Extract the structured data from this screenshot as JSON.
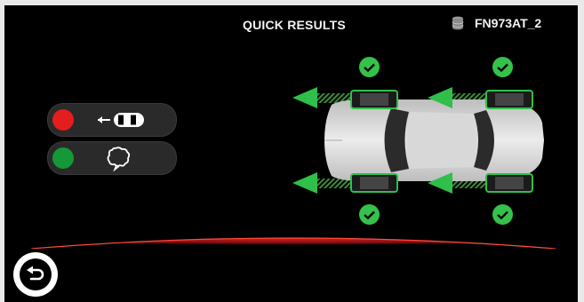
{
  "header": {
    "title": "QUICK RESULTS",
    "vehicle_id": "FN973AT_2",
    "vehicle_icon": "database-icon"
  },
  "legend": [
    {
      "name": "sensor-not-ok",
      "status_color": "#e41d1d",
      "icon": "sensor-tire-icon"
    },
    {
      "name": "sensor-ok",
      "status_color": "#159837",
      "icon": "sensor-speech-icon"
    }
  ],
  "wheels": [
    {
      "position": "front-left",
      "status": "ok",
      "icon": "check-icon"
    },
    {
      "position": "front-right",
      "status": "ok",
      "icon": "check-icon"
    },
    {
      "position": "rear-left",
      "status": "ok",
      "icon": "check-icon"
    },
    {
      "position": "rear-right",
      "status": "ok",
      "icon": "check-icon"
    }
  ],
  "colors": {
    "accent_green": "#2fbf4a",
    "floor_red": "#c2151b",
    "ok_check": "#34c24a"
  },
  "footer": {
    "back_icon": "back-arrow-icon"
  }
}
